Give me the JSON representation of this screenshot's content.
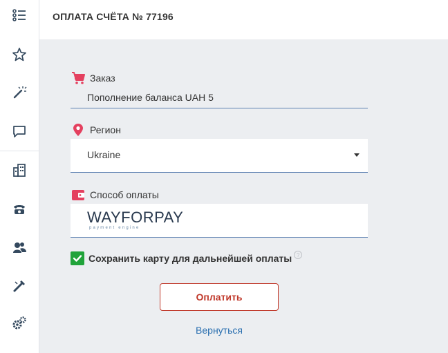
{
  "header": {
    "title": "ОПЛАТА СЧЁТА № 77196"
  },
  "sidebar": {
    "items": [
      {
        "icon": "list-icon"
      },
      {
        "icon": "star-icon"
      },
      {
        "icon": "magic-wand-icon"
      },
      {
        "icon": "chat-icon"
      },
      {
        "icon": "building-icon"
      },
      {
        "icon": "phone-icon"
      },
      {
        "icon": "users-icon"
      },
      {
        "icon": "tools-icon"
      },
      {
        "icon": "gears-icon"
      }
    ]
  },
  "order": {
    "label": "Заказ",
    "value": "Пополнение баланса UAH 5"
  },
  "region": {
    "label": "Регион",
    "value": "Ukraine"
  },
  "payment_method": {
    "label": "Способ оплаты",
    "brand": "WAYFORPAY",
    "brand_sub": "payment engine"
  },
  "save_card": {
    "label": "Сохранить карту для дальнейшей оплаты",
    "checked": true,
    "help": "?"
  },
  "pay_button": {
    "label": "Оплатить"
  },
  "back_link": {
    "label": "Вернуться"
  },
  "colors": {
    "accent_red": "#c0392b",
    "checkbox_green": "#20a33a",
    "link_blue": "#2a6fb0",
    "icon_pink": "#e4405f"
  }
}
